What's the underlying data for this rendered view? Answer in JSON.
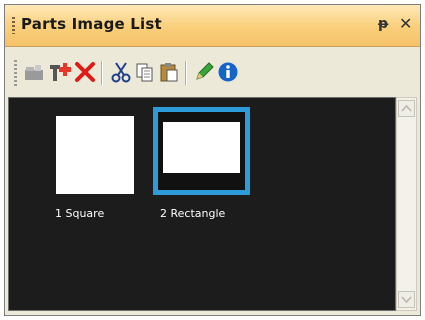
{
  "window": {
    "title": "Parts Image List",
    "pin_glyph": "ᵽ",
    "close_glyph": "✕"
  },
  "toolbar": {
    "buttons": [
      {
        "name": "open-folder-icon"
      },
      {
        "name": "add-part-icon"
      },
      {
        "name": "delete-icon"
      },
      {
        "name": "cut-icon"
      },
      {
        "name": "copy-icon"
      },
      {
        "name": "paste-icon"
      },
      {
        "name": "edit-pencil-icon"
      },
      {
        "name": "info-icon"
      }
    ]
  },
  "items": [
    {
      "label": "1 Square",
      "selected": false
    },
    {
      "label": "2 Rectangle",
      "selected": true
    }
  ],
  "colors": {
    "selection": "#2e9bd9",
    "list_background": "#1c1c1c"
  }
}
